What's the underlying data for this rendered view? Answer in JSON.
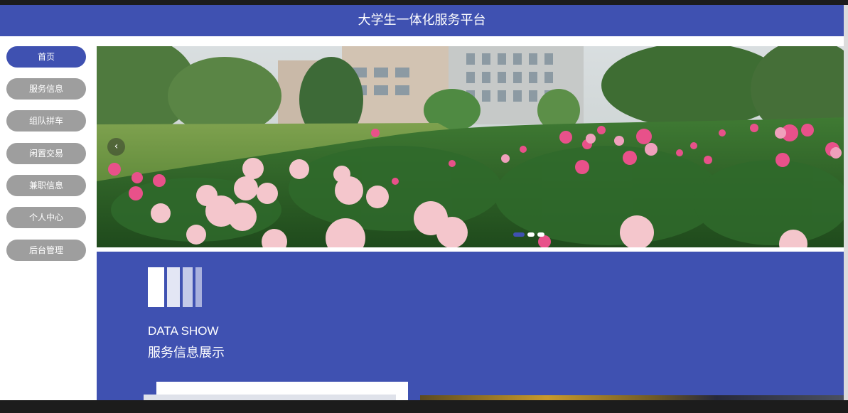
{
  "header": {
    "title": "大学生一体化服务平台"
  },
  "sidebar": {
    "items": [
      {
        "label": "首页",
        "active": true
      },
      {
        "label": "服务信息",
        "active": false
      },
      {
        "label": "组队拼车",
        "active": false
      },
      {
        "label": "闲置交易",
        "active": false
      },
      {
        "label": "兼职信息",
        "active": false
      },
      {
        "label": "个人中心",
        "active": false
      },
      {
        "label": "后台管理",
        "active": false
      }
    ]
  },
  "banner": {
    "prev_icon": "chevron-left-icon",
    "slide_count": 3,
    "active_slide": 1
  },
  "data_section": {
    "title_en": "DATA SHOW",
    "title_zh": "服务信息展示"
  },
  "colors": {
    "primary": "#3f51b1",
    "nav_inactive": "#9e9e9e",
    "white": "#ffffff"
  }
}
